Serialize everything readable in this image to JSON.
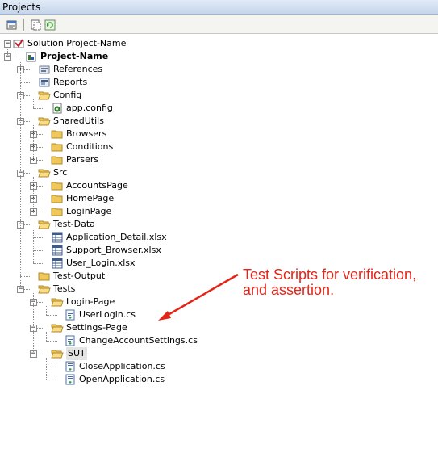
{
  "panel": {
    "title": "Projects"
  },
  "toolbar": {
    "buttons": [
      {
        "name": "properties-button",
        "icon": "properties-icon"
      },
      {
        "name": "show-all-files-button",
        "icon": "show-all-files-icon"
      },
      {
        "name": "refresh-button",
        "icon": "refresh-icon"
      }
    ]
  },
  "tree": [
    {
      "label": "Solution Project-Name",
      "level": 0,
      "icon": "solution-icon",
      "expander": "minus"
    },
    {
      "label": "Project-Name",
      "level": 1,
      "icon": "project-icon",
      "expander": "minus",
      "bold": true
    },
    {
      "label": "References",
      "level": 2,
      "icon": "references-icon",
      "expander": "plus"
    },
    {
      "label": "Reports",
      "level": 2,
      "icon": "reports-icon",
      "expander": "none"
    },
    {
      "label": "Config",
      "level": 2,
      "icon": "folder-open-icon",
      "expander": "minus"
    },
    {
      "label": "app.config",
      "level": 3,
      "icon": "config-file-icon",
      "expander": "none"
    },
    {
      "label": "SharedUtils",
      "level": 2,
      "icon": "folder-open-icon",
      "expander": "minus"
    },
    {
      "label": "Browsers",
      "level": 3,
      "icon": "folder-icon",
      "expander": "plus"
    },
    {
      "label": "Conditions",
      "level": 3,
      "icon": "folder-icon",
      "expander": "plus"
    },
    {
      "label": "Parsers",
      "level": 3,
      "icon": "folder-icon",
      "expander": "plus"
    },
    {
      "label": "Src",
      "level": 2,
      "icon": "folder-open-icon",
      "expander": "minus"
    },
    {
      "label": "AccountsPage",
      "level": 3,
      "icon": "folder-icon",
      "expander": "plus"
    },
    {
      "label": "HomePage",
      "level": 3,
      "icon": "folder-icon",
      "expander": "plus"
    },
    {
      "label": "LoginPage",
      "level": 3,
      "icon": "folder-icon",
      "expander": "plus"
    },
    {
      "label": "Test-Data",
      "level": 2,
      "icon": "folder-open-icon",
      "expander": "minus"
    },
    {
      "label": "Application_Detail.xlsx",
      "level": 3,
      "icon": "excel-file-icon",
      "expander": "none"
    },
    {
      "label": "Support_Browser.xlsx",
      "level": 3,
      "icon": "excel-file-icon",
      "expander": "none"
    },
    {
      "label": "User_Login.xlsx",
      "level": 3,
      "icon": "excel-file-icon",
      "expander": "none"
    },
    {
      "label": "Test-Output",
      "level": 2,
      "icon": "folder-icon",
      "expander": "none"
    },
    {
      "label": "Tests",
      "level": 2,
      "icon": "folder-open-icon",
      "expander": "minus"
    },
    {
      "label": "Login-Page",
      "level": 3,
      "icon": "folder-open-icon",
      "expander": "minus"
    },
    {
      "label": "UserLogin.cs",
      "level": 4,
      "icon": "cs-file-icon",
      "expander": "none"
    },
    {
      "label": "Settings-Page",
      "level": 3,
      "icon": "folder-open-icon",
      "expander": "minus"
    },
    {
      "label": "ChangeAccountSettings.cs",
      "level": 4,
      "icon": "cs-file-icon",
      "expander": "none"
    },
    {
      "label": "SUT",
      "level": 3,
      "icon": "folder-open-icon",
      "expander": "minus",
      "highlight": true
    },
    {
      "label": "CloseApplication.cs",
      "level": 4,
      "icon": "cs-file-icon",
      "expander": "none"
    },
    {
      "label": "OpenApplication.cs",
      "level": 4,
      "icon": "cs-file-icon",
      "expander": "none"
    }
  ],
  "annotation": {
    "text": "Test Scripts for verification, and assertion.",
    "color": "#e52418"
  },
  "colors": {
    "folder": "#f0c85a",
    "folder_border": "#b08a2a",
    "titlebar": "#c5d5ea"
  }
}
